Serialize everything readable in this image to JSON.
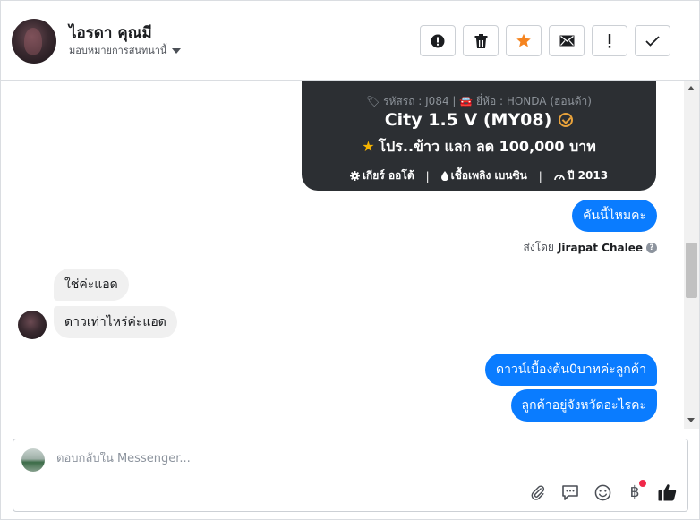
{
  "header": {
    "contact_name": "ไอรดา คุณมี",
    "assign_label": "มอบหมายการสนทนานี้",
    "actions": [
      {
        "icon": "alert-circle-icon"
      },
      {
        "icon": "trash-icon"
      },
      {
        "icon": "star-icon",
        "color": "#f5841f"
      },
      {
        "icon": "envelope-icon"
      },
      {
        "icon": "exclamation-icon"
      },
      {
        "icon": "checkmark-icon"
      }
    ]
  },
  "card": {
    "meta": "🏷 รหัสรถ : J084 | 🚘 ยี่ห้อ : HONDA (ฮอนด้า)",
    "title": "City 1.5 V (MY08)",
    "promo": "โปร..ข้าว แลก ลด 100,000 บาท",
    "specs": {
      "gear": "เกียร์ ออโต้",
      "fuel": "เชื้อเพลิง เบนซิน",
      "year": "ปี 2013"
    }
  },
  "messages": {
    "m1": "คันนี้ไหมคะ",
    "sent_by_prefix": "ส่งโดย",
    "sent_by_name": "Jirapat Chalee",
    "m2": "ใช่ค่ะแอด",
    "m3": "ดาวเท่าไหร่ค่ะแอด",
    "m4": "ดาวน์เบื้องต้น0บาทค่ะลูกค้า",
    "m5": "ลูกค้าอยู่จังหวัดอะไรคะ"
  },
  "composer": {
    "placeholder": "ตอบกลับใน Messenger...",
    "currency_symbol": "฿"
  },
  "colors": {
    "outgoing_bubble": "#0a7cff",
    "incoming_bubble": "#f0f0f0",
    "card_bg": "#2c2f33",
    "accent_star": "#f5841f"
  }
}
